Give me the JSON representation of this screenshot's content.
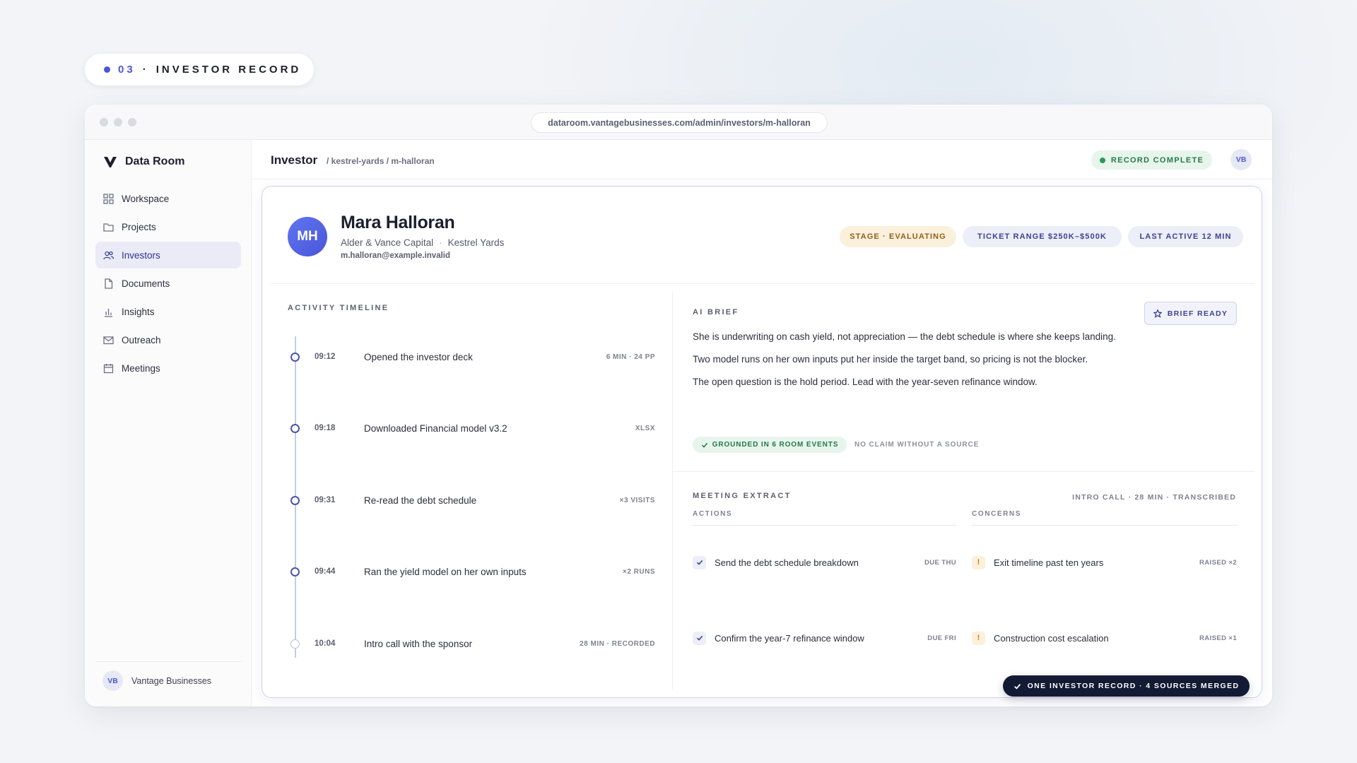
{
  "eyebrow": {
    "number": "03",
    "separator": "·",
    "label": "INVESTOR RECORD"
  },
  "browser": {
    "url": "dataroom.vantagebusinesses.com/admin/investors/m-halloran"
  },
  "sidebar": {
    "brand": "Data Room",
    "items": [
      {
        "label": "Workspace",
        "icon": "grid-icon"
      },
      {
        "label": "Projects",
        "icon": "folder-icon"
      },
      {
        "label": "Investors",
        "icon": "users-icon",
        "active": true
      },
      {
        "label": "Documents",
        "icon": "document-icon"
      },
      {
        "label": "Insights",
        "icon": "bar-chart-icon"
      },
      {
        "label": "Outreach",
        "icon": "mail-icon"
      },
      {
        "label": "Meetings",
        "icon": "calendar-icon"
      }
    ],
    "footer": {
      "avatar": "VB",
      "name": "Vantage Businesses"
    }
  },
  "topbar": {
    "title": "Investor",
    "breadcrumb": "/ kestrel-yards / m-halloran",
    "status": "RECORD COMPLETE",
    "avatar": "VB"
  },
  "profile": {
    "initials": "MH",
    "name": "Mara Halloran",
    "company": "Alder & Vance Capital",
    "separator": "·",
    "project": "Kestrel Yards",
    "email": "m.halloran@example.invalid",
    "chips": {
      "stage": "STAGE · EVALUATING",
      "ticket": "TICKET RANGE $250K–$500K",
      "active": "LAST ACTIVE 12 MIN"
    }
  },
  "timeline": {
    "label": "ACTIVITY TIMELINE",
    "items": [
      {
        "time": "09:12",
        "text": "Opened the investor deck",
        "meta": "6 MIN · 24 PP"
      },
      {
        "time": "09:18",
        "text": "Downloaded Financial model v3.2",
        "meta": "XLSX"
      },
      {
        "time": "09:31",
        "text": "Re-read the debt schedule",
        "meta": "×3 VISITS"
      },
      {
        "time": "09:44",
        "text": "Ran the yield model on her own inputs",
        "meta": "×2 RUNS"
      },
      {
        "time": "10:04",
        "text": "Intro call with the sponsor",
        "meta": "28 MIN · RECORDED"
      }
    ]
  },
  "brief": {
    "label": "AI BRIEF",
    "button": "BRIEF READY",
    "lines": [
      "She is underwriting on cash yield, not appreciation — the debt schedule is where she keeps landing.",
      "Two model runs on her own inputs put her inside the target band, so pricing is not the blocker.",
      "The open question is the hold period. Lead with the year-seven refinance window."
    ],
    "grounded": "GROUNDED IN 6 ROOM EVENTS",
    "no_claim": "NO CLAIM WITHOUT A SOURCE"
  },
  "extract": {
    "label": "MEETING EXTRACT",
    "meta": "INTRO CALL · 28 MIN · TRANSCRIBED",
    "actions_label": "ACTIONS",
    "concerns_label": "CONCERNS",
    "actions": [
      {
        "text": "Send the debt schedule breakdown",
        "due": "DUE THU"
      },
      {
        "text": "Confirm the year-7 refinance window",
        "due": "DUE FRI"
      }
    ],
    "concerns": [
      {
        "text": "Exit timeline past ten years",
        "raised": "RAISED ×2"
      },
      {
        "text": "Construction cost escalation",
        "raised": "RAISED ×1"
      }
    ]
  },
  "merged_badge": "ONE INVESTOR RECORD · 4 SOURCES MERGED",
  "colors": {
    "accent": "#4b57d6",
    "success": "#2a9a5a",
    "warning": "#c47a13",
    "dark": "#131a33"
  }
}
